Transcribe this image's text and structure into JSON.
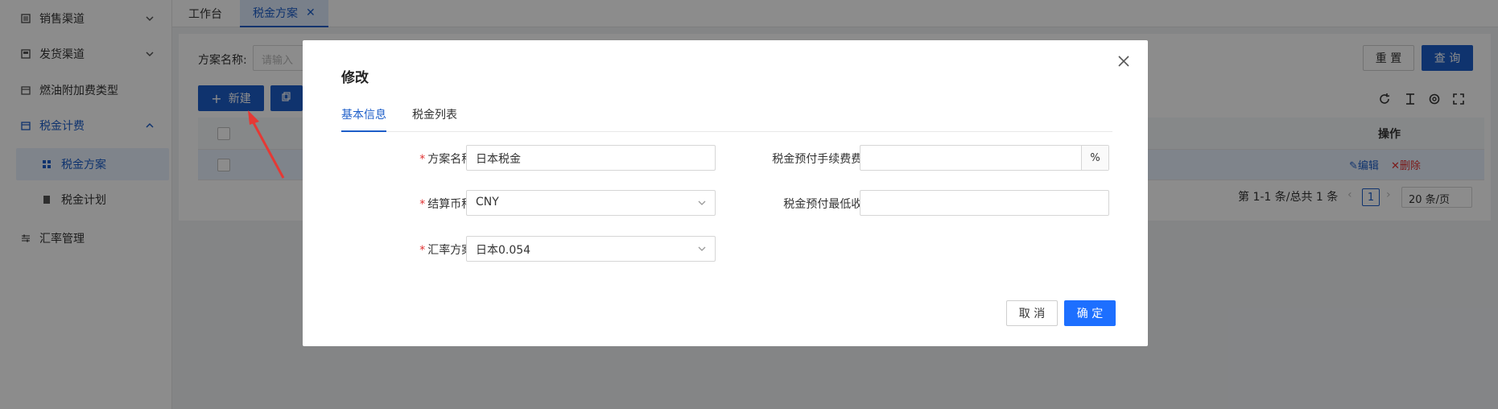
{
  "sidebar": {
    "items": [
      {
        "label": "销售渠道",
        "icon": "list-icon"
      },
      {
        "label": "发货渠道",
        "icon": "table-icon"
      },
      {
        "label": "燃油附加费类型",
        "icon": "calendar-icon"
      },
      {
        "label": "税金计费",
        "icon": "calendar-icon"
      },
      {
        "label": "税金方案",
        "icon": "grid-icon"
      },
      {
        "label": "税金计划",
        "icon": "document-icon"
      },
      {
        "label": "汇率管理",
        "icon": "sliders-icon"
      }
    ]
  },
  "tabs": [
    {
      "label": "工作台"
    },
    {
      "label": "税金方案"
    }
  ],
  "search": {
    "label": "方案名称:",
    "placeholder": "请输入"
  },
  "toolbar": {
    "reset_label": "重 置",
    "query_label": "查 询",
    "new_label": "新建"
  },
  "table": {
    "action_header": "操作",
    "edit_label": "编辑",
    "delete_label": "删除"
  },
  "pagination": {
    "summary": "第 1-1 条/总共 1 条",
    "current_page": "1",
    "page_size": "20 条/页"
  },
  "modal": {
    "title": "修改",
    "tabs": [
      {
        "label": "基本信息"
      },
      {
        "label": "税金列表"
      }
    ],
    "fields": {
      "scheme_name": {
        "label": "方案名称:",
        "value": "日本税金"
      },
      "currency": {
        "label": "结算币种:",
        "value": "CNY"
      },
      "rate_scheme": {
        "label": "汇率方案:",
        "value": "日本0.054"
      },
      "prepay_fee_rate": {
        "label": "税金预付手续费费率:",
        "value": "",
        "suffix": "%"
      },
      "prepay_min_fee": {
        "label": "税金预付最低收费:",
        "value": ""
      }
    },
    "cancel_label": "取 消",
    "confirm_label": "确 定"
  },
  "colors": {
    "primary": "#1d5ec9",
    "danger": "#e03131",
    "arrow": "#e53935"
  }
}
